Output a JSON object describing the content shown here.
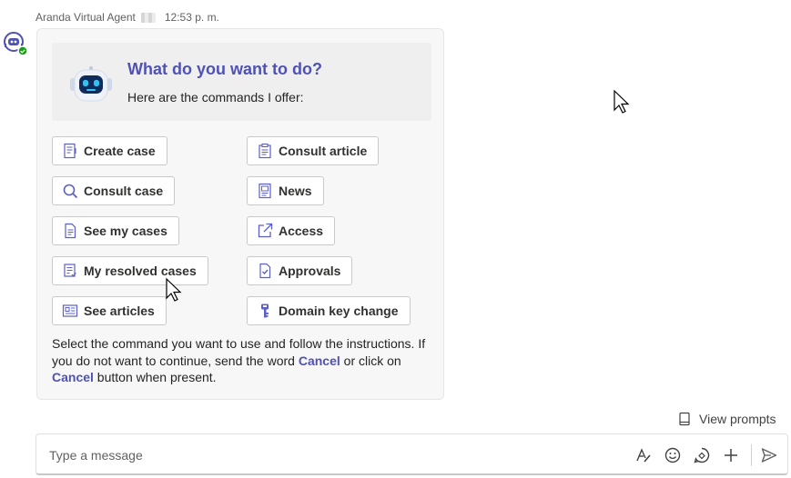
{
  "message": {
    "sender": "Aranda Virtual Agent",
    "time": "12:53 p. m."
  },
  "card": {
    "title": "What do you want to do?",
    "subtitle": "Here are the commands I offer:",
    "commands_left": [
      {
        "label": "Create case",
        "icon": "create-case-icon"
      },
      {
        "label": "Consult case",
        "icon": "search-icon"
      },
      {
        "label": "See my cases",
        "icon": "document-icon"
      },
      {
        "label": "My resolved cases",
        "icon": "resolved-list-icon"
      },
      {
        "label": "See articles",
        "icon": "articles-icon"
      }
    ],
    "commands_right": [
      {
        "label": "Consult article",
        "icon": "clipboard-icon"
      },
      {
        "label": "News",
        "icon": "news-icon"
      },
      {
        "label": "Access",
        "icon": "external-link-icon"
      },
      {
        "label": "Approvals",
        "icon": "checked-document-icon"
      },
      {
        "label": "Domain key change",
        "icon": "key-icon"
      }
    ],
    "instructions": {
      "part1": "Select the command you want to use and follow the instructions. If you do not want to continue, send the word ",
      "link1": "Cancel",
      "part2": " or click on ",
      "link2": "Cancel",
      "part3": " button when present."
    }
  },
  "view_prompts": "View prompts",
  "composer": {
    "placeholder": "Type a message"
  },
  "colors": {
    "accent": "#4f52b2",
    "presence": "#13a10e"
  }
}
